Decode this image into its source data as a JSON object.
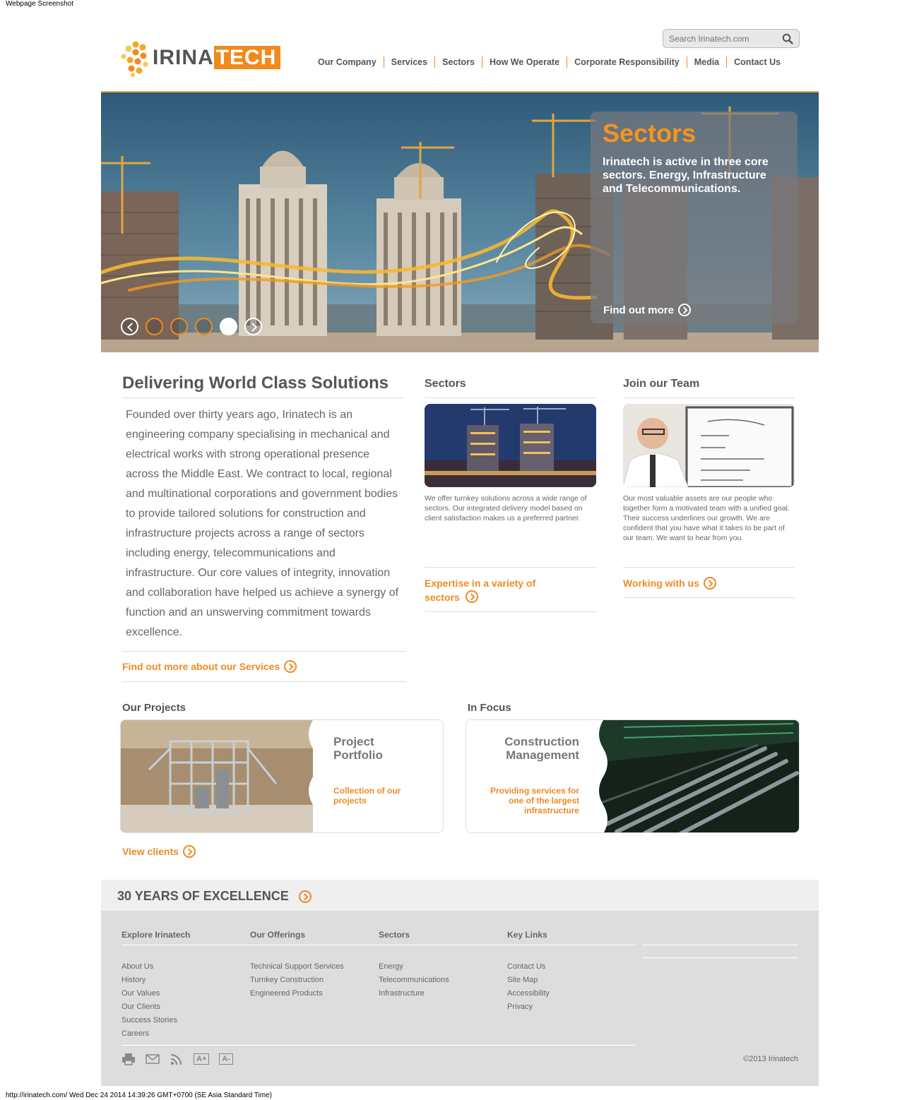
{
  "caption": "Webpage Screenshot",
  "status_line": "http://irinatech.com/ Wed Dec 24 2014 14:39:26 GMT+0700 (SE Asia Standard Time)",
  "logo": {
    "part1": "IRINA",
    "part2": "TECH",
    "brand_color": "#f08a1c"
  },
  "search": {
    "placeholder": "Search Irinatech.com",
    "icon": "search-icon"
  },
  "nav": [
    "Our Company",
    "Services",
    "Sectors",
    "How We Operate",
    "Corporate Responsibility",
    "Media",
    "Contact Us"
  ],
  "hero": {
    "title": "Sectors",
    "text": "Irinatech is active in three core sectors. Energy, Infrastructure and Telecommunications.",
    "link": "Find out more",
    "slides": 5,
    "active_slide": 5
  },
  "intro": {
    "title": "Delivering World Class Solutions",
    "text": "Founded over thirty years ago, Irinatech is an engineering company specialising in mechanical and electrical works with strong operational presence across the Middle East. We contract to local, regional and multinational corporations and government bodies to provide tailored solutions for construction and infrastructure projects across a range of sectors including energy, telecommunications and infrastructure. Our core values of integrity, innovation and collaboration have helped us achieve a synergy of function and an unswerving commitment towards excellence.",
    "link": "Find out more about our Services"
  },
  "sectors_col": {
    "title": "Sectors",
    "text": "We offer turnkey solutions across a wide range of sectors. Our integrated delivery model based on client satisfaction makes us a preferred partner.",
    "link": "Expertise in a variety of sectors"
  },
  "team_col": {
    "title": "Join our Team",
    "text": "Our most valuable assets are our people who together form a motivated team with a unified goal. Their success underlines our growth. We are confident that you have what it takes to be part of our team. We want to hear from you.",
    "link": "Working with us"
  },
  "projects": {
    "title": "Our Projects",
    "card_title": "Project Portfolio",
    "card_sub": "Collection of our projects",
    "link": "View clients"
  },
  "focus": {
    "title": "In Focus",
    "card_title": "Construction Management",
    "card_sub": "Providing services for one of the largest infrastructure"
  },
  "excellence": "30 YEARS OF EXCELLENCE",
  "footer": {
    "columns": [
      {
        "title": "Explore Irinatech",
        "items": [
          "About Us",
          "History",
          "Our Values",
          "Our Clients",
          "Success Stories",
          "Careers"
        ]
      },
      {
        "title": "Our Offerings",
        "items": [
          "Technical Support Services",
          "Turnkey Construction",
          "Engineered Products"
        ]
      },
      {
        "title": "Sectors",
        "items": [
          "Energy",
          "Telecommunications",
          "Infrastructure"
        ]
      },
      {
        "title": "Key Links",
        "items": [
          "Contact Us",
          "Site Map",
          "Accessibility",
          "Privacy"
        ]
      }
    ],
    "font_up": "A+",
    "font_down": "A-",
    "copyright": "©2013 Irinatech"
  }
}
